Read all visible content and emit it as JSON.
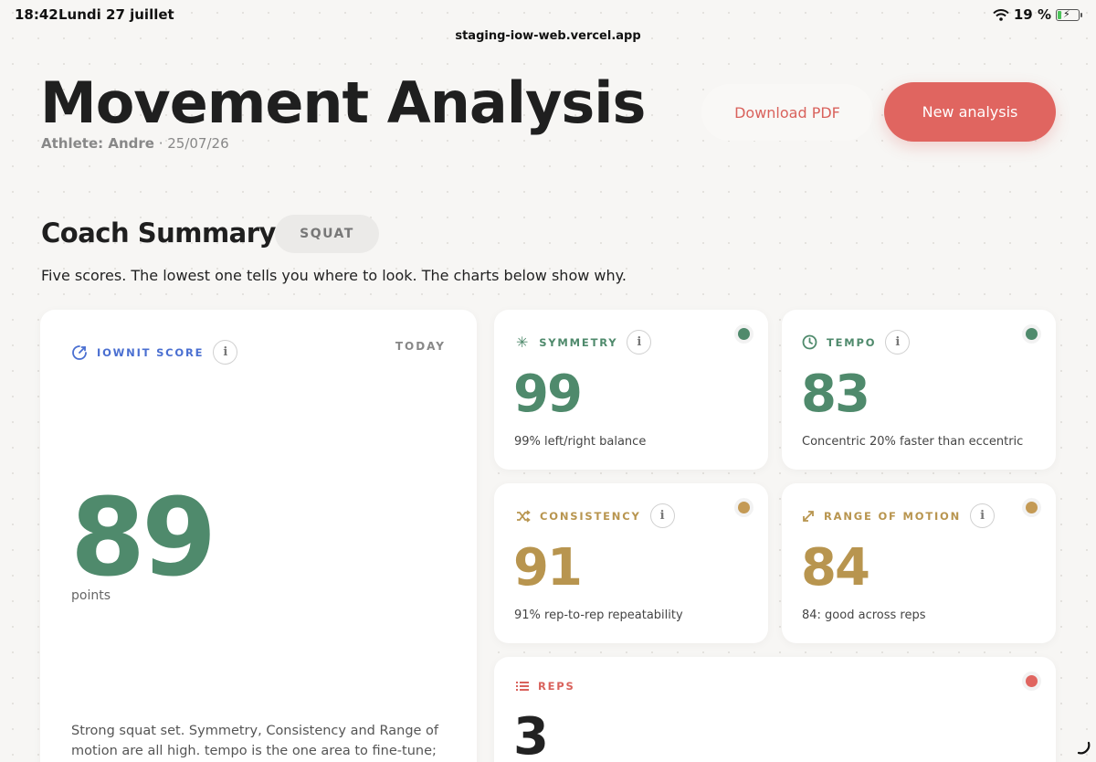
{
  "status_bar": {
    "time": "18:42",
    "date": "Lundi 27 juillet",
    "battery": "19 %",
    "battery_level": 0.19
  },
  "browser": {
    "url": "staging-iow-web.vercel.app"
  },
  "header": {
    "title": "Movement Analysis",
    "athlete": "Athlete: Andre",
    "separator": " · ",
    "date": "25/07/26",
    "download_label": "Download PDF",
    "new_analysis_label": "New analysis"
  },
  "summary": {
    "title": "Coach Summary",
    "exercise": "SQUAT",
    "description": "Five scores. The lowest one tells you where to look. The charts below show why."
  },
  "main_score": {
    "label": "IOWNIT SCORE",
    "info": "i",
    "period": "TODAY",
    "value": "89",
    "unit": "points",
    "note": "Strong squat set. Symmetry, Consistency and Range of motion are all high. tempo is the one area to fine-tune; the"
  },
  "metrics": {
    "symmetry": {
      "label": "SYMMETRY",
      "info": "i",
      "value": "99",
      "caption": "99% left/right balance",
      "status_color": "#4f8a6c"
    },
    "tempo": {
      "label": "TEMPO",
      "info": "i",
      "value": "83",
      "caption": "Concentric 20% faster than eccentric",
      "status_color": "#4f8a6c"
    },
    "consistency": {
      "label": "CONSISTENCY",
      "info": "i",
      "value": "91",
      "caption": "91% rep-to-rep repeatability",
      "status_color": "#c49a55"
    },
    "range_of_motion": {
      "label": "RANGE OF MOTION",
      "info": "i",
      "value": "84",
      "caption": "84: good across reps",
      "status_color": "#c49a55"
    },
    "reps": {
      "label": "REPS",
      "value": "3",
      "status_color": "#e06560"
    }
  },
  "colors": {
    "green": "#4f8a6c",
    "gold": "#b8954f",
    "red": "#d9625c",
    "blue": "#4a6fd1"
  }
}
